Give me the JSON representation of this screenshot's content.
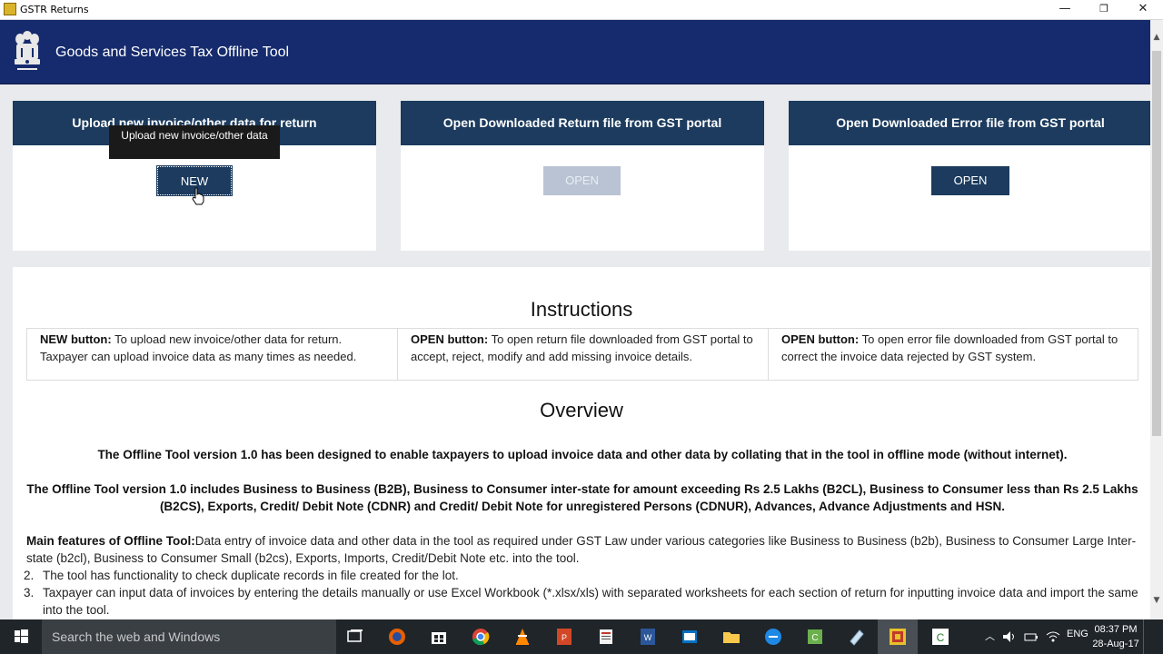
{
  "window": {
    "title": "GSTR Returns",
    "minimize": "—",
    "maximize": "❐",
    "close": "✕"
  },
  "header": {
    "title": "Goods and Services Tax Offline Tool",
    "emblem_icon": "national-emblem-icon"
  },
  "cards": [
    {
      "heading": "Upload new invoice/other data for return",
      "button": "NEW",
      "state": "hover"
    },
    {
      "heading": "Open Downloaded Return file from GST portal",
      "button": "OPEN",
      "state": "disabled"
    },
    {
      "heading": "Open Downloaded Error file from GST portal",
      "button": "OPEN",
      "state": "enabled"
    }
  ],
  "tooltip": "Upload new invoice/other data",
  "instructions": {
    "heading": "Instructions",
    "items": [
      {
        "label": "NEW button:",
        "text": " To upload new invoice/other data for return. Taxpayer can upload invoice data as many times as needed."
      },
      {
        "label": "OPEN button:",
        "text": " To open return file downloaded from GST portal to accept, reject, modify and add missing invoice details."
      },
      {
        "label": "OPEN button:",
        "text": " To open error file downloaded from GST portal to correct the invoice data rejected by GST system."
      }
    ]
  },
  "overview": {
    "heading": "Overview",
    "para1": "The Offline Tool version 1.0 has been designed to enable taxpayers to upload invoice data and other data by collating that in the tool in offline mode (without internet).",
    "para2": "The Offline Tool version 1.0 includes Business to Business (B2B), Business to Consumer inter-state for amount exceeding Rs 2.5 Lakhs (B2CL), Business to Consumer less than Rs 2.5 Lakhs (B2CS), Exports, Credit/ Debit Note (CDNR) and Credit/ Debit Note for unregistered Persons (CDNUR), Advances, Advance Adjustments and HSN.",
    "features_label": "Main features of Offline Tool:",
    "features": [
      {
        "num": "",
        "text": "Data entry of invoice data and other data in the tool as required under GST Law under various categories like Business to Business (b2b), Business to Consumer Large Inter-state (b2cl), Business to Consumer Small (b2cs), Exports, Imports, Credit/Debit Note etc. into the tool."
      },
      {
        "num": "2.",
        "text": "The tool has functionality to check duplicate records in file created for the lot."
      },
      {
        "num": "3.",
        "text": "Taxpayer can input data of invoices by entering the details manually or use Excel Workbook (*.xlsx/xls) with separated worksheets for each section of return for inputting invoice data and import the same into the tool."
      }
    ]
  },
  "taskbar": {
    "search_placeholder": "Search the web and Windows",
    "language": "ENG",
    "time": "08:37 PM",
    "date": "28-Aug-17"
  }
}
